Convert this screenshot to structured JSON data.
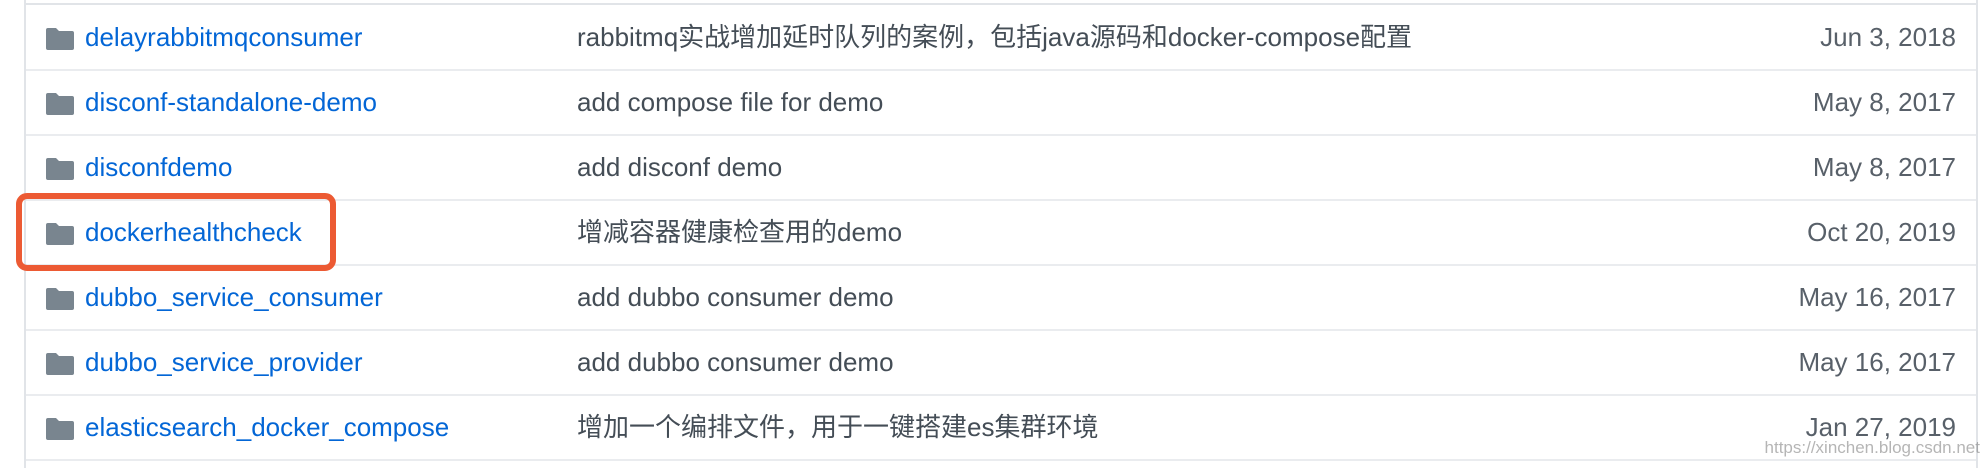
{
  "rows": [
    {
      "icon": "folder-icon",
      "name": "delayrabbitmqconsumer",
      "message": "rabbitmq实战增加延时队列的案例，包括java源码和docker-compose配置",
      "date": "Jun 3, 2018"
    },
    {
      "icon": "folder-icon",
      "name": "disconf-standalone-demo",
      "message": "add compose file for demo",
      "date": "May 8, 2017"
    },
    {
      "icon": "folder-icon",
      "name": "disconfdemo",
      "message": "add disconf demo",
      "date": "May 8, 2017"
    },
    {
      "icon": "folder-icon",
      "name": "dockerhealthcheck",
      "message": "增减容器健康检查用的demo",
      "date": "Oct 20, 2019"
    },
    {
      "icon": "folder-icon",
      "name": "dubbo_service_consumer",
      "message": "add dubbo consumer demo",
      "date": "May 16, 2017"
    },
    {
      "icon": "folder-icon",
      "name": "dubbo_service_provider",
      "message": "add dubbo consumer demo",
      "date": "May 16, 2017"
    },
    {
      "icon": "folder-icon",
      "name": "elasticsearch_docker_compose",
      "message": "增加一个编排文件，用于一键搭建es集群环境",
      "date": "Jan 27, 2019"
    }
  ],
  "highlight": {
    "target": "dockerhealthcheck",
    "color": "#ec5a33"
  },
  "watermark": "https://xinchen.blog.csdn.net",
  "colors": {
    "link": "#0366d6",
    "folder_icon": "#79858f",
    "border": "#e1e4e8"
  }
}
